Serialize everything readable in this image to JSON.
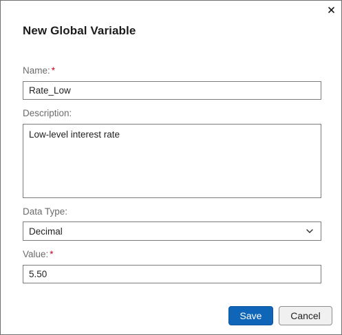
{
  "dialog": {
    "title": "New Global Variable",
    "close_icon": "close-icon"
  },
  "form": {
    "name": {
      "label": "Name:",
      "required_mark": "*",
      "value": "Rate_Low"
    },
    "description": {
      "label": "Description:",
      "value": "Low-level interest rate"
    },
    "data_type": {
      "label": "Data Type:",
      "selected": "Decimal",
      "icon": "chevron-down-icon"
    },
    "value": {
      "label": "Value:",
      "required_mark": "*",
      "value": "5.50"
    }
  },
  "buttons": {
    "save_label": "Save",
    "cancel_label": "Cancel"
  },
  "colors": {
    "primary": "#0f66b8",
    "required": "#d0021b",
    "label": "#6b6b6b",
    "border": "#7a7a7a"
  }
}
